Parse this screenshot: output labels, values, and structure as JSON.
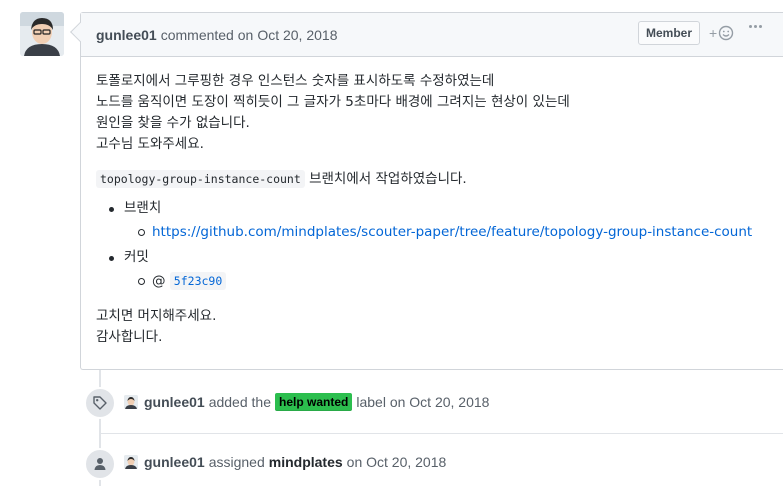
{
  "comment": {
    "author": "gunlee01",
    "action": "commented on",
    "date": "Oct 20, 2018",
    "badge": "Member",
    "reaction_plus": "+",
    "body": {
      "lines": [
        "토폴로지에서 그루핑한 경우 인스턴스 숫자를 표시하도록 수정하였는데",
        "노드를 움직이면 도장이 찍히듯이 그 글자가 5초마다 배경에 그려지는 현상이 있는데",
        "원인을 찾을 수가 없습니다.",
        "고수님 도와주세요."
      ],
      "branch_code": "topology-group-instance-count",
      "branch_suffix": " 브랜치에서 작업하였습니다.",
      "list": [
        {
          "label": "브랜치",
          "link": "https://github.com/mindplates/scouter-paper/tree/feature/topology-group-instance-count"
        },
        {
          "label": "커밋",
          "prefix": "@ ",
          "commit": "5f23c90"
        }
      ],
      "closing": [
        "고치면 머지해주세요.",
        "감사합니다."
      ]
    }
  },
  "events": [
    {
      "icon": "tag-icon",
      "author": "gunlee01",
      "pre": "added the",
      "label": "help wanted",
      "post": "label on Oct 20, 2018"
    },
    {
      "icon": "person-icon",
      "author": "gunlee01",
      "pre": "assigned",
      "assignee": "mindplates",
      "post": "on Oct 20, 2018"
    }
  ],
  "colors": {
    "label_bg": "#2cbe4e",
    "link": "#0366d6",
    "border": "#d1d5da",
    "header_bg": "#f6f8fa"
  }
}
